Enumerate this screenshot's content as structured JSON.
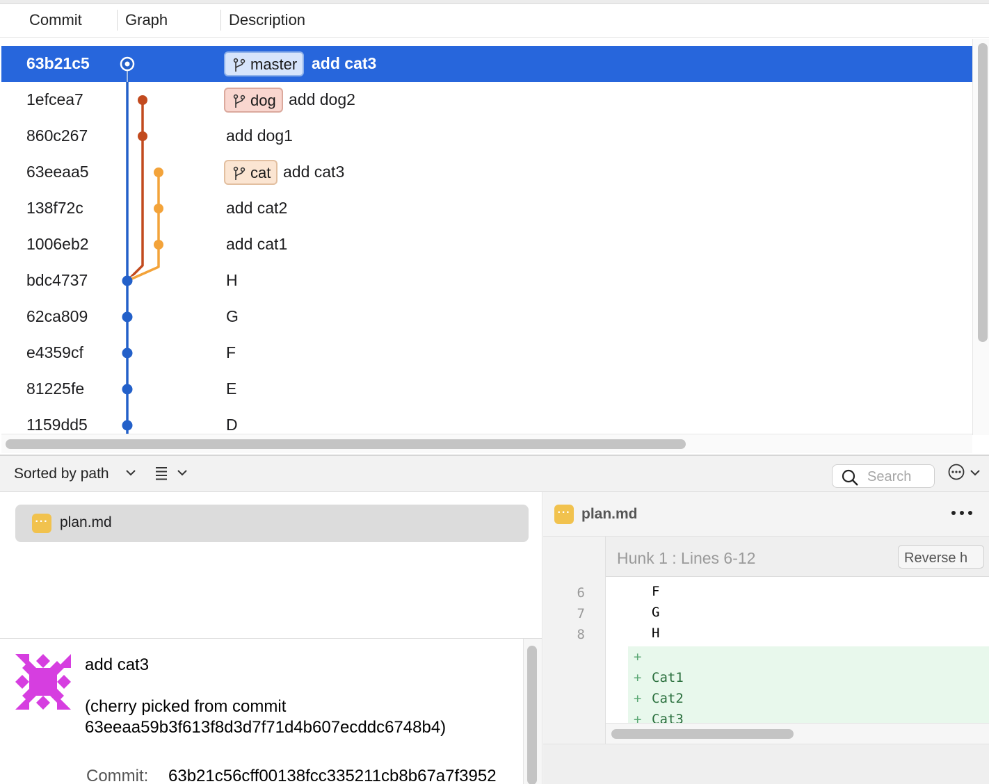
{
  "columns": {
    "commit": "Commit",
    "graph": "Graph",
    "description": "Description"
  },
  "commits": [
    {
      "hash": "63b21c5",
      "description": "add cat3",
      "branch": "master",
      "selected": true
    },
    {
      "hash": "1efcea7",
      "description": "add dog2",
      "branch": "dog"
    },
    {
      "hash": "860c267",
      "description": "add dog1"
    },
    {
      "hash": "63eeaa5",
      "description": "add cat3",
      "branch": "cat"
    },
    {
      "hash": "138f72c",
      "description": "add cat2"
    },
    {
      "hash": "1006eb2",
      "description": "add cat1"
    },
    {
      "hash": "bdc4737",
      "description": "H"
    },
    {
      "hash": "62ca809",
      "description": "G"
    },
    {
      "hash": "e4359cf",
      "description": "F"
    },
    {
      "hash": "81225fe",
      "description": "E"
    },
    {
      "hash": "1159dd5",
      "description": "D"
    }
  ],
  "graph_colors": {
    "master": "#2360c9",
    "dog": "#c24a1e",
    "cat": "#f3a33a"
  },
  "toolbar": {
    "sort_label": "Sorted by path",
    "search_placeholder": "Search",
    "icons": [
      "chevron-down-icon",
      "list-icon",
      "search-icon",
      "more-circle-icon"
    ]
  },
  "files": [
    {
      "name": "plan.md",
      "status_glyph": "···"
    }
  ],
  "commit_info": {
    "title": "add cat3",
    "body_line1": "(cherry picked from commit",
    "body_line2": "63eeaa59b3f613f8d3d7f71d4b607ecddc6748b4)",
    "commit_label": "Commit:",
    "commit_hash": "63b21c56cff00138fcc335211cb8b67a7f3952"
  },
  "diff": {
    "file_name": "plan.md",
    "hunk_label": "Hunk 1 : Lines 6-12",
    "reverse_button": "Reverse h",
    "context_lines": [
      {
        "number": "6",
        "text": "F"
      },
      {
        "number": "7",
        "text": "G"
      },
      {
        "number": "8",
        "text": "H"
      }
    ],
    "added_lines": [
      "",
      "Cat1",
      "Cat2",
      "Cat3"
    ],
    "plus_sign": "+"
  }
}
